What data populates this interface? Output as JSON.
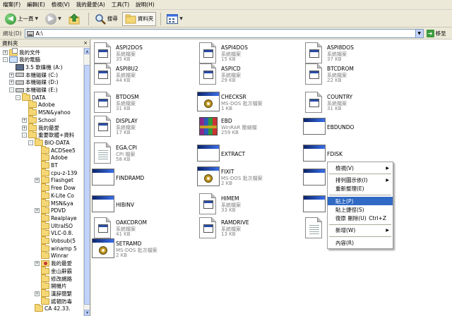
{
  "menubar": [
    "檔案(F)",
    "編輯(E)",
    "檢視(V)",
    "我的最愛(A)",
    "工具(T)",
    "說明(H)"
  ],
  "toolbar": {
    "back_label": "上一頁",
    "search_label": "搜尋",
    "folders_label": "資料夾"
  },
  "address": {
    "label": "網址(D)",
    "value": "A:\\",
    "go_label": "移至"
  },
  "folders_pane": {
    "title": "資料夾",
    "close": "×",
    "tree": [
      {
        "label": "我的文件",
        "icon": "docs-folder-icon",
        "level": 1,
        "exp": "+"
      },
      {
        "label": "我的電腦",
        "icon": "computer-icon",
        "level": 1,
        "exp": "-"
      },
      {
        "label": "3.5 軟碟機 (A:)",
        "icon": "floppy-icon",
        "level": 2,
        "exp": ""
      },
      {
        "label": "本機磁碟 (C:)",
        "icon": "drive-icon",
        "level": 2,
        "exp": "+"
      },
      {
        "label": "本機磁碟 (D:)",
        "icon": "drive-icon",
        "level": 2,
        "exp": "+"
      },
      {
        "label": "本機磁碟 (E:)",
        "icon": "drive-icon",
        "level": 2,
        "exp": "-"
      },
      {
        "label": "DATA",
        "icon": "folder-icon",
        "level": 3,
        "exp": "-"
      },
      {
        "label": "Adobe",
        "icon": "folder-icon",
        "level": 4,
        "exp": ""
      },
      {
        "label": "MSN&yahoo",
        "icon": "folder-icon",
        "level": 4,
        "exp": ""
      },
      {
        "label": "School",
        "icon": "folder-icon",
        "level": 4,
        "exp": "+"
      },
      {
        "label": "我的最愛",
        "icon": "folder-icon",
        "level": 4,
        "exp": "+"
      },
      {
        "label": "重要軟體+資料",
        "icon": "folder-icon",
        "level": 4,
        "exp": "-"
      },
      {
        "label": "BIO-DATA",
        "icon": "folder-icon",
        "level": 5,
        "exp": "-"
      },
      {
        "label": "ACDSee5",
        "icon": "folder-icon",
        "level": 6,
        "exp": ""
      },
      {
        "label": "Adobe",
        "icon": "folder-icon",
        "level": 6,
        "exp": ""
      },
      {
        "label": "BT",
        "icon": "folder-icon",
        "level": 6,
        "exp": ""
      },
      {
        "label": "cpu-z-139",
        "icon": "folder-icon",
        "level": 6,
        "exp": ""
      },
      {
        "label": "Flashget",
        "icon": "folder-icon",
        "level": 6,
        "exp": "+"
      },
      {
        "label": "Free Dow",
        "icon": "folder-icon",
        "level": 6,
        "exp": ""
      },
      {
        "label": "K-Lite Co",
        "icon": "folder-icon",
        "level": 6,
        "exp": ""
      },
      {
        "label": "MSN&ya",
        "icon": "folder-icon",
        "level": 6,
        "exp": ""
      },
      {
        "label": "PDVD",
        "icon": "folder-icon",
        "level": 6,
        "exp": "+"
      },
      {
        "label": "Realplaye",
        "icon": "folder-icon",
        "level": 6,
        "exp": ""
      },
      {
        "label": "UltraISO",
        "icon": "folder-icon",
        "level": 6,
        "exp": ""
      },
      {
        "label": "VLC-0.8.",
        "icon": "folder-icon",
        "level": 6,
        "exp": ""
      },
      {
        "label": "Vobsub(5",
        "icon": "folder-icon",
        "level": 6,
        "exp": ""
      },
      {
        "label": "winamp 5",
        "icon": "folder-icon",
        "level": 6,
        "exp": ""
      },
      {
        "label": "Winrar",
        "icon": "folder-icon",
        "level": 6,
        "exp": ""
      },
      {
        "label": "我的最愛",
        "icon": "special-folder-icon",
        "level": 6,
        "exp": "+"
      },
      {
        "label": "金山辭霸",
        "icon": "folder-icon",
        "level": 6,
        "exp": ""
      },
      {
        "label": "修改網路",
        "icon": "folder-icon",
        "level": 6,
        "exp": ""
      },
      {
        "label": "開機片",
        "icon": "folder-icon",
        "level": 6,
        "exp": ""
      },
      {
        "label": "漢辞簡繁",
        "icon": "folder-icon",
        "level": 6,
        "exp": "+"
      },
      {
        "label": "諾頓防毒",
        "icon": "folder-icon",
        "level": 6,
        "exp": ""
      },
      {
        "label": "CA 42.33.",
        "icon": "folder-icon",
        "level": 5,
        "exp": ""
      }
    ]
  },
  "files": [
    {
      "name": "ASPI2DOS",
      "type": "系統檔案",
      "size": "35 KB",
      "icon": "sys-file-icon"
    },
    {
      "name": "ASPI4DOS",
      "type": "系統檔案",
      "size": "15 KB",
      "icon": "sys-file-icon"
    },
    {
      "name": "ASPI8DOS",
      "type": "系統檔案",
      "size": "37 KB",
      "icon": "sys-file-icon"
    },
    {
      "name": "ASPI8U2",
      "type": "系統檔案",
      "size": "44 KB",
      "icon": "sys-file-icon"
    },
    {
      "name": "ASPICD",
      "type": "系統檔案",
      "size": "29 KB",
      "icon": "sys-file-icon"
    },
    {
      "name": "BTCDROM",
      "type": "系統檔案",
      "size": "22 KB",
      "icon": "sys-file-icon"
    },
    {
      "name": "BTDOSM",
      "type": "系統檔案",
      "size": "31 KB",
      "icon": "sys-file-icon"
    },
    {
      "name": "CHECKSR",
      "type": "MS-DOS 批次檔案",
      "size": "1 KB",
      "icon": "batch-file-icon"
    },
    {
      "name": "COUNTRY",
      "type": "系統檔案",
      "size": "31 KB",
      "icon": "sys-file-icon"
    },
    {
      "name": "DISPLAY",
      "type": "系統檔案",
      "size": "17 KB",
      "icon": "sys-file-icon"
    },
    {
      "name": "EBD",
      "type": "WinRAR 壓縮檔",
      "size": "259 KB",
      "icon": "winrar-archive-icon"
    },
    {
      "name": "EBDUNDO",
      "type": "",
      "size": "",
      "icon": "application-icon"
    },
    {
      "name": "EGA.CPI",
      "type": "CPI 檔案",
      "size": "58 KB",
      "icon": "text-file-icon"
    },
    {
      "name": "EXTRACT",
      "type": "",
      "size": "",
      "icon": "application-icon"
    },
    {
      "name": "FDISK",
      "type": "",
      "size": "",
      "icon": "application-icon"
    },
    {
      "name": "FINDRAMD",
      "type": "",
      "size": "",
      "icon": "application-icon"
    },
    {
      "name": "FIXIT",
      "type": "MS-DOS 批次檔案",
      "size": "2 KB",
      "icon": "batch-file-icon"
    },
    {
      "name": "",
      "type": "",
      "size": "",
      "icon": "application-icon"
    },
    {
      "name": "HIBINV",
      "type": "",
      "size": "",
      "icon": "application-icon"
    },
    {
      "name": "HIMEM",
      "type": "系統檔案",
      "size": "33 KB",
      "icon": "sys-file-icon"
    },
    {
      "name": "",
      "type": "",
      "size": "",
      "icon": "application-icon"
    },
    {
      "name": "OAKCDROM",
      "type": "系統檔案",
      "size": "41 KB",
      "icon": "sys-file-icon"
    },
    {
      "name": "RAMDRIVE",
      "type": "系統檔案",
      "size": "13 KB",
      "icon": "sys-file-icon"
    },
    {
      "name": "",
      "type": "",
      "size": "",
      "icon": "text-file-icon"
    },
    {
      "name": "SETRAMD",
      "type": "MS-DOS 批次檔案",
      "size": "2 KB",
      "icon": "batch-file-icon"
    }
  ],
  "context_menu": {
    "items": [
      {
        "label": "檢視(V)",
        "submenu": true,
        "shortcut": "",
        "highlight": false
      },
      {
        "sep": true
      },
      {
        "label": "排列圖示依(I)",
        "submenu": true,
        "shortcut": "",
        "highlight": false
      },
      {
        "label": "重新整理(E)",
        "submenu": false,
        "shortcut": "",
        "highlight": false
      },
      {
        "sep": true
      },
      {
        "label": "貼上(P)",
        "submenu": false,
        "shortcut": "",
        "highlight": true
      },
      {
        "label": "貼上捷徑(S)",
        "submenu": false,
        "shortcut": "",
        "highlight": false
      },
      {
        "label": "復原 刪除(U)",
        "submenu": false,
        "shortcut": "Ctrl+Z",
        "highlight": false
      },
      {
        "sep": true
      },
      {
        "label": "新增(W)",
        "submenu": true,
        "shortcut": "",
        "highlight": false
      },
      {
        "sep": true
      },
      {
        "label": "內容(R)",
        "submenu": false,
        "shortcut": "",
        "highlight": false
      }
    ]
  }
}
